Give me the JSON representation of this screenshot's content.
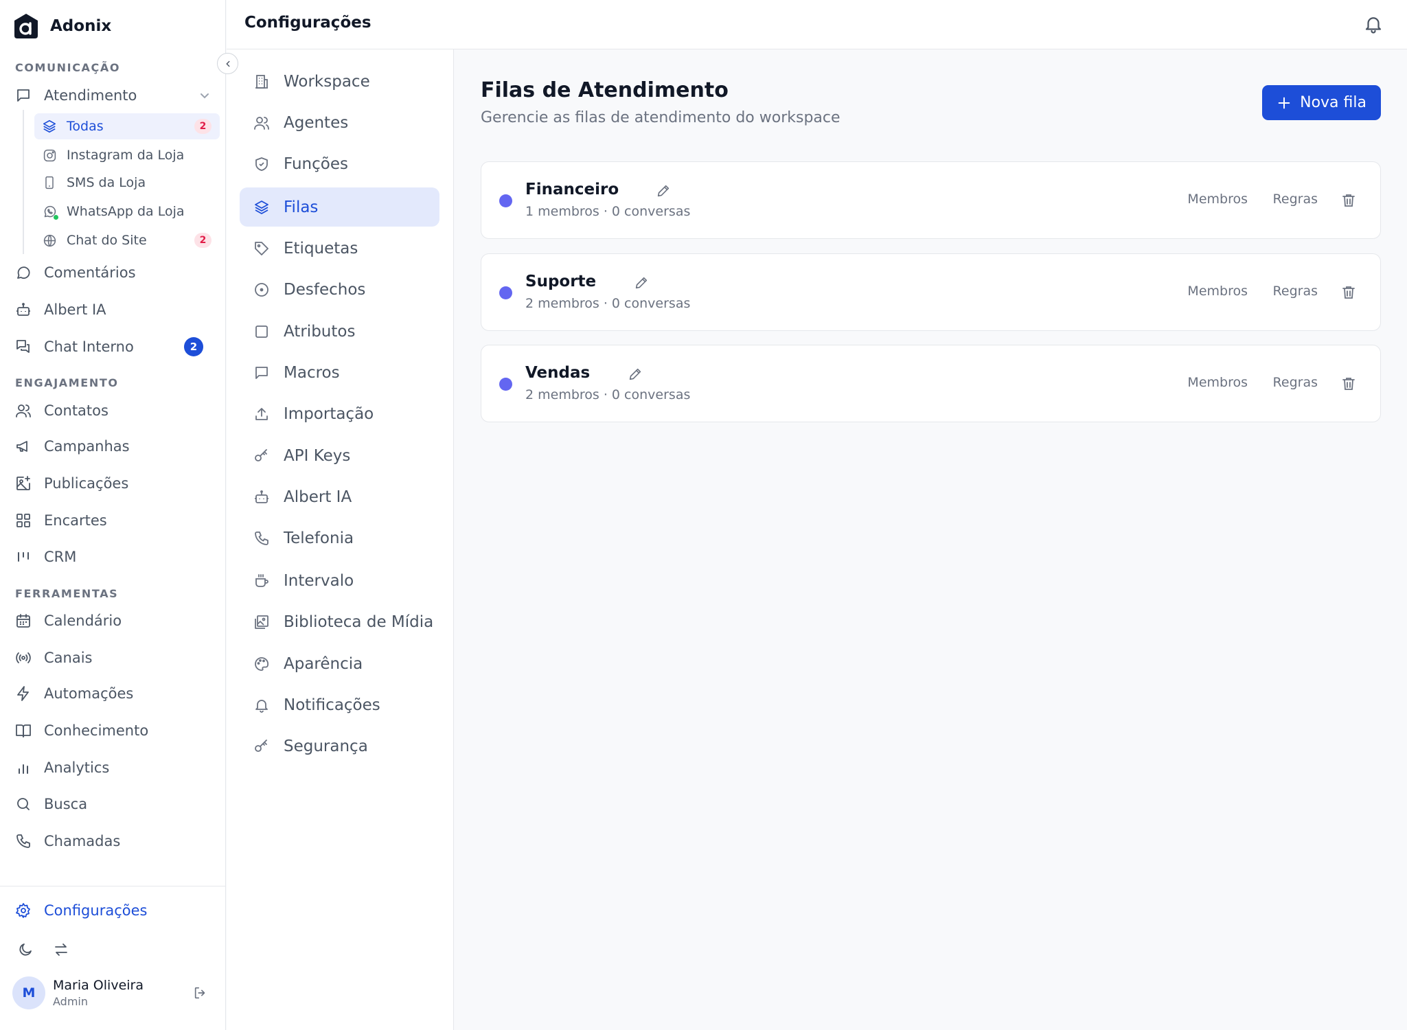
{
  "brand": {
    "name": "Adonix"
  },
  "sidebar": {
    "sections": {
      "comunicacao": "COMUNICAÇÃO",
      "engajamento": "ENGAJAMENTO",
      "ferramentas": "FERRAMENTAS"
    },
    "atendimento": {
      "label": "Atendimento",
      "icon": "message-square-icon",
      "subitems": [
        {
          "label": "Todas",
          "icon": "layers-icon",
          "badge": "2",
          "active": true
        },
        {
          "label": "Instagram da Loja",
          "icon": "instagram-icon"
        },
        {
          "label": "SMS da Loja",
          "icon": "smartphone-icon"
        },
        {
          "label": "WhatsApp da Loja",
          "icon": "whatsapp-icon"
        },
        {
          "label": "Chat do Site",
          "icon": "globe-icon",
          "badge": "2"
        }
      ]
    },
    "comunicacao_items": [
      {
        "label": "Comentários",
        "icon": "message-circle-icon"
      },
      {
        "label": "Albert IA",
        "icon": "bot-icon"
      },
      {
        "label": "Chat Interno",
        "icon": "messages-icon",
        "badge": "2"
      }
    ],
    "engajamento_items": [
      {
        "label": "Contatos",
        "icon": "users-icon"
      },
      {
        "label": "Campanhas",
        "icon": "megaphone-icon"
      },
      {
        "label": "Publicações",
        "icon": "image-plus-icon"
      },
      {
        "label": "Encartes",
        "icon": "grid-icon"
      },
      {
        "label": "CRM",
        "icon": "kanban-icon"
      }
    ],
    "ferramentas_items": [
      {
        "label": "Calendário",
        "icon": "calendar-icon"
      },
      {
        "label": "Canais",
        "icon": "radio-icon"
      },
      {
        "label": "Automações",
        "icon": "zap-icon"
      },
      {
        "label": "Conhecimento",
        "icon": "book-icon"
      },
      {
        "label": "Analytics",
        "icon": "bar-chart-icon"
      },
      {
        "label": "Busca",
        "icon": "search-icon"
      },
      {
        "label": "Chamadas",
        "icon": "phone-icon"
      }
    ],
    "settings_label": "Configurações",
    "user": {
      "initial": "M",
      "name": "Maria Oliveira",
      "role": "Admin"
    }
  },
  "topbar": {
    "title": "Configurações"
  },
  "settings_menu": [
    {
      "label": "Workspace",
      "icon": "building-icon"
    },
    {
      "label": "Agentes",
      "icon": "users-icon"
    },
    {
      "label": "Funções",
      "icon": "shield-check-icon"
    },
    {
      "label": "Filas",
      "icon": "layers-icon",
      "active": true
    },
    {
      "label": "Etiquetas",
      "icon": "tag-icon"
    },
    {
      "label": "Desfechos",
      "icon": "circle-dot-icon"
    },
    {
      "label": "Atributos",
      "icon": "square-icon"
    },
    {
      "label": "Macros",
      "icon": "message-square-icon"
    },
    {
      "label": "Importação",
      "icon": "upload-icon"
    },
    {
      "label": "API Keys",
      "icon": "key-icon"
    },
    {
      "label": "Albert IA",
      "icon": "bot-icon"
    },
    {
      "label": "Telefonia",
      "icon": "phone-icon"
    },
    {
      "label": "Intervalo",
      "icon": "coffee-icon"
    },
    {
      "label": "Biblioteca de Mídia",
      "icon": "images-icon"
    },
    {
      "label": "Aparência",
      "icon": "palette-icon"
    },
    {
      "label": "Notificações",
      "icon": "bell-icon"
    },
    {
      "label": "Segurança",
      "icon": "key-icon"
    }
  ],
  "main": {
    "title": "Filas de Atendimento",
    "subtitle": "Gerencie as filas de atendimento do workspace",
    "new_button": "Nova fila",
    "queues": [
      {
        "name": "Financeiro",
        "meta": "1 membros · 0 conversas",
        "members_label": "Membros",
        "rules_label": "Regras",
        "color": "#6366f1"
      },
      {
        "name": "Suporte",
        "meta": "2 membros · 0 conversas",
        "members_label": "Membros",
        "rules_label": "Regras",
        "color": "#6366f1"
      },
      {
        "name": "Vendas",
        "meta": "2 membros · 0 conversas",
        "members_label": "Membros",
        "rules_label": "Regras",
        "color": "#6366f1"
      }
    ]
  },
  "colors": {
    "accent": "#1d4ed8",
    "queue_dot": "#6366f1",
    "badge_pink": "#e11d48",
    "online": "#22c55e"
  }
}
